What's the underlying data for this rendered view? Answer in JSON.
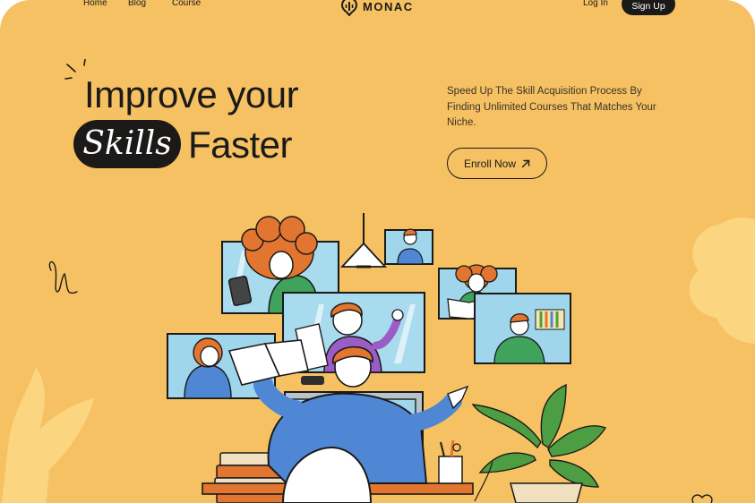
{
  "nav": {
    "links": [
      "Home",
      "Blog",
      "Course"
    ],
    "brand": "MONAC",
    "login": "Log In",
    "signup": "Sign Up"
  },
  "hero": {
    "headline_line1": "Improve your",
    "highlight": "Skills",
    "headline_line2_rest": "Faster",
    "tagline": "Speed Up The Skill Acquisition Process By Finding Unlimited Courses That Matches Your Niche.",
    "cta_label": "Enroll Now",
    "cta_icon": "arrow-up-right-icon"
  },
  "colors": {
    "background": "#f6c163",
    "ink": "#1b1a19",
    "blob": "#fbd57f",
    "screen_blue": "#9fd6ec",
    "shirt_blue": "#4f87d4",
    "hair_orange": "#e2752f",
    "purple": "#9a5dc6",
    "green": "#3fa35b",
    "plant_green": "#4d9e43"
  },
  "illustration": "online-learning-scene"
}
